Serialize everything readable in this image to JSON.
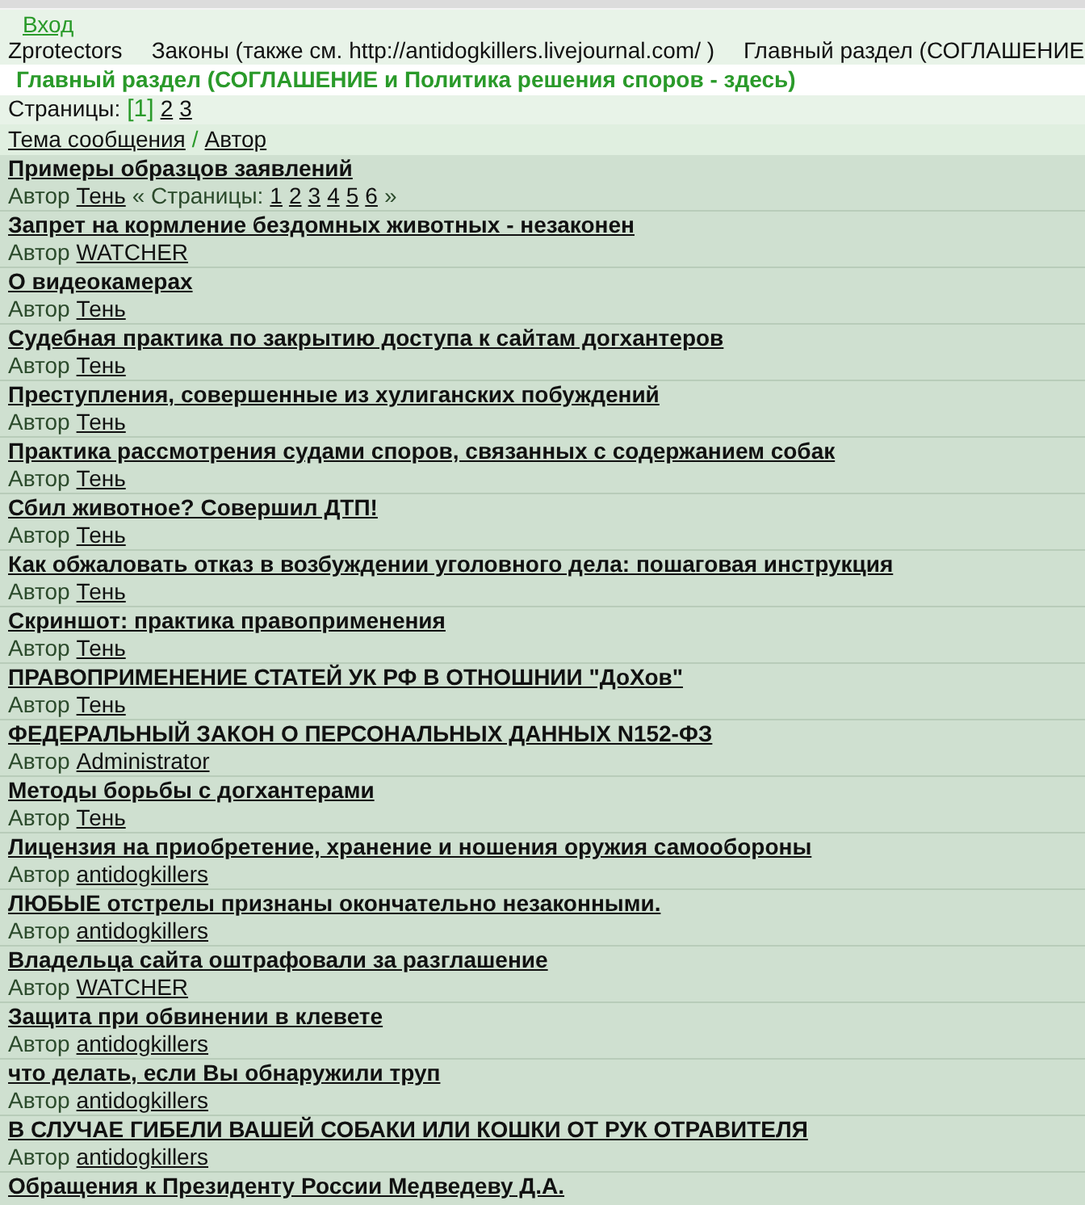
{
  "login": "Вход",
  "breadcrumb": [
    "Zprotectors",
    "Законы (также см. http://antidogkillers.livejournal.com/ )",
    "Главный раздел (СОГЛАШЕНИЕ"
  ],
  "heading": "Главный раздел (СОГЛАШЕНИЕ и Политика решения споров - здесь)",
  "pages": {
    "label": "Страницы:",
    "items": [
      {
        "label": "[1]",
        "selected": true
      },
      {
        "label": "2",
        "selected": false
      },
      {
        "label": "3",
        "selected": false
      }
    ]
  },
  "columns": {
    "topic": "Тема сообщения",
    "separator": "/",
    "author": "Автор"
  },
  "topics": [
    {
      "title": "Примеры образцов заявлений",
      "author_label": "Автор",
      "author": "Тень",
      "subpages": {
        "open": "« Страницы:",
        "items": [
          "1",
          "2",
          "3",
          "4",
          "5",
          "6"
        ],
        "close": "»"
      }
    },
    {
      "title": "Запрет на кормление бездомных животных - незаконен",
      "author_label": "Автор",
      "author": "WATCHER"
    },
    {
      "title": "О видеокамерах",
      "author_label": "Автор",
      "author": "Тень"
    },
    {
      "title": "Судебная практика по закрытию доступа к сайтам догхантеров",
      "author_label": "Автор",
      "author": "Тень"
    },
    {
      "title": "Преступления, совершенные из хулиганских побуждений",
      "author_label": "Автор",
      "author": "Тень"
    },
    {
      "title": "Практика рассмотрения судами споров, связанных с содержанием собак",
      "author_label": "Автор",
      "author": "Тень"
    },
    {
      "title": "Сбил животное? Совершил ДТП!",
      "author_label": "Автор",
      "author": "Тень"
    },
    {
      "title": "Как обжаловать отказ в возбуждении уголовного дела: пошаговая инструкция",
      "author_label": "Автор",
      "author": "Тень"
    },
    {
      "title": "Скриншот: практика правоприменения",
      "author_label": "Автор",
      "author": "Тень"
    },
    {
      "title": "ПРАВОПРИМЕНЕНИЕ СТАТЕЙ УК РФ В ОТНОШНИИ \"ДоХов\"",
      "author_label": "Автор",
      "author": "Тень"
    },
    {
      "title": "ФЕДЕРАЛЬНЫЙ ЗАКОН О ПЕРСОНАЛЬНЫХ ДАННЫХ N152-ФЗ",
      "author_label": "Автор",
      "author": "Administrator"
    },
    {
      "title": "Методы борьбы с догхантерами",
      "author_label": "Автор",
      "author": "Тень"
    },
    {
      "title": "Лицензия на приобретение, хранение и ношения оружия самообороны",
      "author_label": "Автор",
      "author": "antidogkillers"
    },
    {
      "title": "ЛЮБЫЕ отстрелы признаны окончательно незаконными.",
      "author_label": "Автор",
      "author": "antidogkillers"
    },
    {
      "title": "Владельца сайта оштрафовали за разглашение",
      "author_label": "Автор",
      "author": "WATCHER"
    },
    {
      "title": "Защита при обвинении в клевете",
      "author_label": "Автор",
      "author": "antidogkillers"
    },
    {
      "title": "что делать, если Вы обнаружили труп",
      "author_label": "Автор",
      "author": "antidogkillers"
    },
    {
      "title": "В СЛУЧАЕ ГИБЕЛИ ВАШЕЙ СОБАКИ ИЛИ КОШКИ ОТ РУК ОТРАВИТЕЛЯ",
      "author_label": "Автор",
      "author": "antidogkillers"
    },
    {
      "title": "Обращения к Президенту России Медведеву Д.А."
    }
  ]
}
